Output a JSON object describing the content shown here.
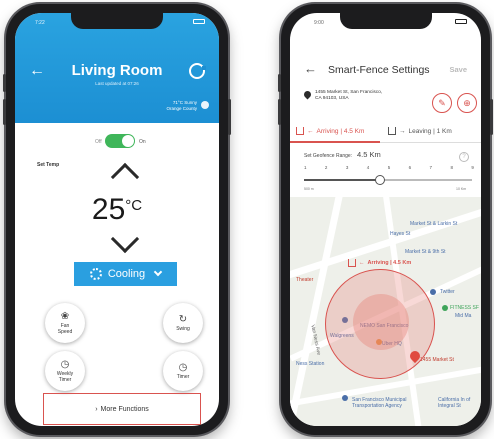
{
  "left_app": {
    "status_time": "7:22",
    "title": "Living Room",
    "last_updated": "Last updated at 07:26",
    "weather_line1": "71°C Sunny",
    "weather_line2": "Orange County",
    "toggle": {
      "off_label": "Off",
      "on_label": "On",
      "state": "on"
    },
    "set_temp_label": "Set Temp",
    "temperature": "25",
    "temperature_unit": "°C",
    "mode_label": "Cooling",
    "controls": {
      "fan": {
        "label_line1": "Fan",
        "label_line2": "Speed"
      },
      "swing": {
        "label": "Swing"
      },
      "weekly_timer": {
        "label_line1": "Weekly",
        "label_line2": "Timer"
      },
      "timer": {
        "label": "Timer"
      }
    },
    "more_functions_label": "More Functions",
    "colors": {
      "header": "#1c8fd3",
      "toggle_on": "#3fb65a",
      "accent": "#2a9fe0",
      "border": "#d9534f"
    }
  },
  "right_app": {
    "status_time": "9:00",
    "title": "Smart-Fence Settings",
    "save_label": "Save",
    "address_line1": "1455 Market St, San Francisco,",
    "address_line2": "CA 94103, USA",
    "tabs": {
      "arriving": "Arriving | 4.5 Km",
      "leaving": "Leaving | 1 Km"
    },
    "range_label": "Set Geofence Range:",
    "range_value": "4.5 Km",
    "scale": [
      "1",
      "2",
      "3",
      "4",
      "5",
      "6",
      "7",
      "8",
      "9"
    ],
    "slider_min": "500 m",
    "slider_max": "10 Km",
    "slider_value_fraction": 0.45,
    "map": {
      "arriving_tag": "Arriving | 4.5 Km",
      "labels": {
        "market_larkin": "Market St & Larkin St",
        "hayes": "Hayes St",
        "market_9th": "Market St & 9th St",
        "theater": "Theater",
        "twitter": "Twitter",
        "fitness": "FITNESS SF",
        "mid_ma": "Mid Ma",
        "san_francisco": "NEMO San Francisco",
        "walgreens": "Walgreens",
        "uber": "Uber HQ",
        "market_addr": "1455 Market St",
        "van_ness": "Van Ness Ave",
        "ness_station": "Ness Station",
        "sf_transport": "San Francisco Municipal Transportation Agency",
        "california": "California In of Integral St"
      }
    },
    "colors": {
      "accent": "#d9534f",
      "geofence_fill": "#e6786e"
    }
  }
}
